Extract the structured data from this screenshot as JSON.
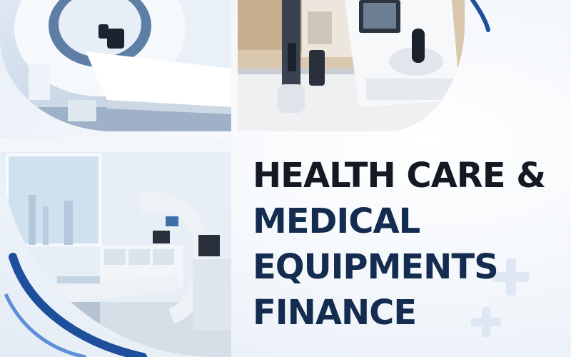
{
  "headline": {
    "line1": "HEALTH CARE &",
    "line2": "MEDICAL",
    "line3": "EQUIPMENTS",
    "line4": "FINANCE"
  },
  "colors": {
    "headline_dark": "#141a24",
    "headline_navy": "#142c4f",
    "accent_arc": "#1d4f9c",
    "accent_light": "#5b8fd6",
    "background": "#eef3f9"
  },
  "images": [
    {
      "name": "ct-scanner-photo",
      "subject": "CT scanner with patient table"
    },
    {
      "name": "ophthalmic-equipment-photo",
      "subject": "ophthalmic diagnostic device with joystick"
    },
    {
      "name": "hospital-room-photo",
      "subject": "hospital room with C-arm x-ray machine"
    }
  ],
  "icons": [
    "plus-icon",
    "plus-icon"
  ]
}
